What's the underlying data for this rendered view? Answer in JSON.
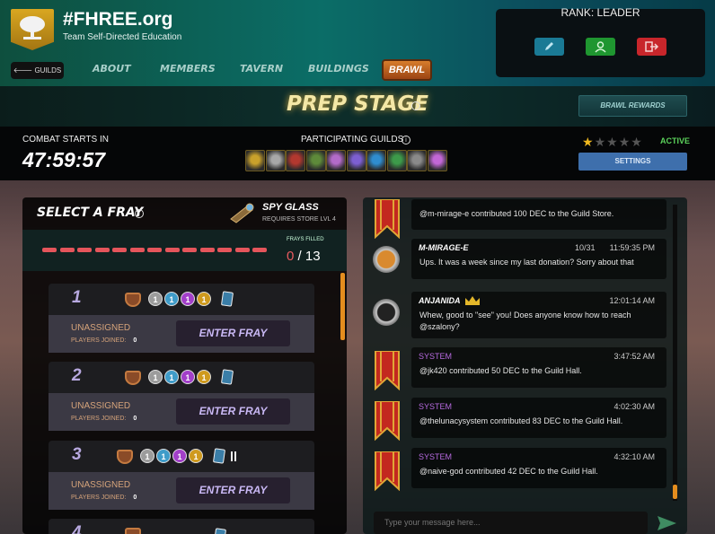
{
  "header": {
    "site_title": "#FHREE.org",
    "site_subtitle": "Team Self-Directed Education",
    "guilds_button": "🡐 GUILDS",
    "nav": [
      "ABOUT",
      "MEMBERS",
      "TAVERN",
      "BUILDINGS",
      "BRAWL"
    ],
    "rank": "RANK: LEADER",
    "accent_color": "#0b6d67",
    "rank_buttons": [
      {
        "icon": "pencil-icon",
        "color": "#1a7a95"
      },
      {
        "icon": "user-icon",
        "color": "#1f9630"
      },
      {
        "icon": "exit-icon",
        "color": "#c8262b"
      }
    ]
  },
  "stage": {
    "title": "PREP STAGE",
    "info_glyph": "i",
    "brawl_rewards": "BRAWL REWARDS"
  },
  "info_bar": {
    "combat_label": "COMBAT STARTS IN",
    "timer": "47:59:57",
    "participating_label": "PARTICIPATING GUILDS",
    "guild_colors": [
      "#c9a12b",
      "#a8a8a8",
      "#b2382f",
      "#5e8a3a",
      "#b36bc9",
      "#7d5fd1",
      "#2f8dcf",
      "#3d9a4a",
      "#8a8a8a",
      "#c267d6"
    ],
    "rating_stars": 1,
    "rating_max": 5,
    "status": "ACTIVE",
    "settings": "SETTINGS"
  },
  "left_panel": {
    "title": "SELECT A FRAY",
    "spy_title": "SPY GLASS",
    "spy_sub": "REQUIRES STORE LVL 4",
    "frays_filled_label": "FRAYS FILLED",
    "frays_filled": "0",
    "frays_total": "/ 13",
    "progress_segments": 13,
    "frays": [
      {
        "number": "1",
        "chips": [
          "1",
          "1",
          "1",
          "1"
        ],
        "status": "UNASSIGNED",
        "players_label": "PLAYERS JOINED:",
        "players": "0",
        "button": "ENTER FRAY"
      },
      {
        "number": "2",
        "chips": [
          "1",
          "1",
          "1",
          "1"
        ],
        "status": "UNASSIGNED",
        "players_label": "PLAYERS JOINED:",
        "players": "0",
        "button": "ENTER FRAY"
      },
      {
        "number": "3",
        "chips": [
          "1",
          "1",
          "1",
          "1"
        ],
        "status": "UNASSIGNED",
        "players_label": "PLAYERS JOINED:",
        "players": "0",
        "button": "ENTER FRAY"
      },
      {
        "number": "4"
      }
    ]
  },
  "chat": {
    "messages": [
      {
        "author": "",
        "time": "",
        "text": "@m-mirage-e contributed 100 DEC to the Guild Store.",
        "avatar": "banner"
      },
      {
        "author": "M-MIRAGE-E",
        "date": "10/31",
        "time": "11:59:35 PM",
        "text": "Ups. It was a week since my last donation? Sorry about that",
        "avatar": "badge"
      },
      {
        "author": "ANJANIDA",
        "date": "",
        "time": "12:01:14 AM",
        "text": "Whew, good to \"see\" you! Does anyone know how to reach @szalony?",
        "avatar": "badge"
      },
      {
        "author": "SYSTEM",
        "time": "3:47:52 AM",
        "text": "@jk420 contributed 50 DEC to the Guild Hall.",
        "avatar": "banner"
      },
      {
        "author": "SYSTEM",
        "time": "4:02:30 AM",
        "text": "@thelunacysystem contributed 83 DEC to the Guild Hall.",
        "avatar": "banner"
      },
      {
        "author": "SYSTEM",
        "time": "4:32:10 AM",
        "text": "@naive-god contributed 42 DEC to the Guild Hall.",
        "avatar": "banner"
      }
    ],
    "input_placeholder": "Type your message here..."
  }
}
